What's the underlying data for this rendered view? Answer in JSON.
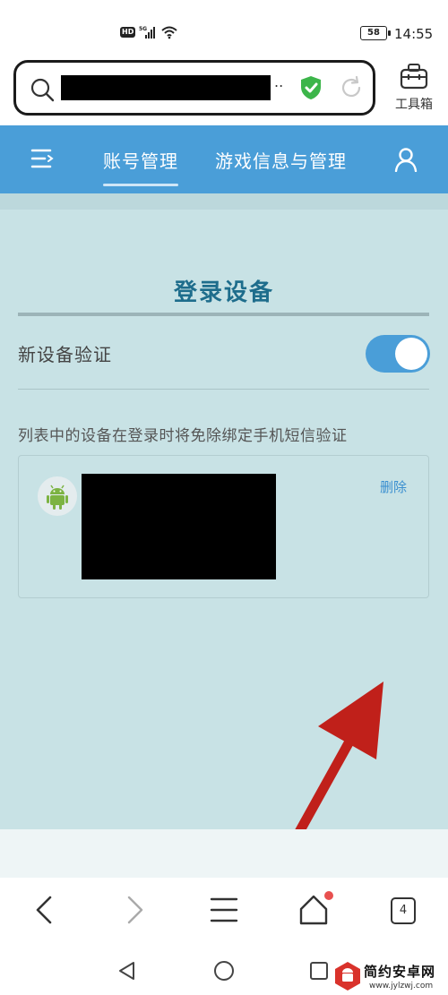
{
  "status_bar": {
    "network_badge": "HD",
    "network_type": "5G",
    "battery": "58",
    "time": "14:55"
  },
  "address_bar": {
    "url_suffix": "..",
    "toolbox_label": "工具箱"
  },
  "nav": {
    "tabs": [
      {
        "label": "账号管理",
        "active": true
      },
      {
        "label": "游戏信息与管理",
        "active": false
      }
    ]
  },
  "main": {
    "title": "登录设备",
    "setting": {
      "label": "新设备验证",
      "enabled": true
    },
    "hint": "列表中的设备在登录时将免除绑定手机短信验证",
    "devices": [
      {
        "platform_icon": "android-icon",
        "delete_label": "删除"
      }
    ]
  },
  "bottom_bar": {
    "tab_count": "4"
  },
  "watermark": {
    "name": "简约安卓网",
    "url": "www.jylzwj.com"
  },
  "colors": {
    "accent": "#4a9ed8",
    "title": "#1e6d8c",
    "content_bg": "#c8e2e5",
    "arrow": "#c0201a",
    "android": "#7cb342"
  }
}
